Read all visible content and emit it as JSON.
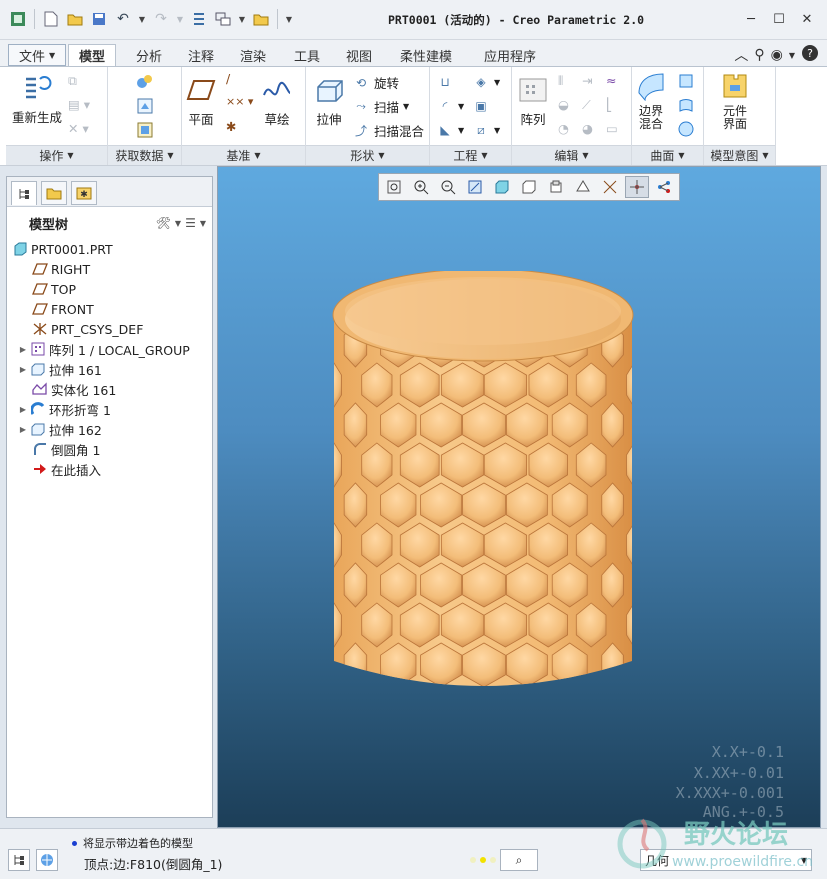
{
  "window": {
    "title": "PRT0001 (活动的) - Creo Parametric 2.0"
  },
  "tabs": [
    {
      "label": "文件",
      "kind": "file"
    },
    {
      "label": "模型",
      "kind": "active"
    },
    {
      "label": "分析"
    },
    {
      "label": "注释"
    },
    {
      "label": "渲染"
    },
    {
      "label": "工具"
    },
    {
      "label": "视图"
    },
    {
      "label": "柔性建模"
    },
    {
      "label": "应用程序"
    }
  ],
  "ribbon": {
    "operations": {
      "regenerate": "重新生成",
      "group": "操作"
    },
    "get_data": {
      "group": "获取数据"
    },
    "datum": {
      "plane": "平面",
      "sketch": "草绘",
      "group": "基准"
    },
    "shapes": {
      "extrude": "拉伸",
      "revolve": "旋转",
      "sweep": "扫描",
      "swept_blend": "扫描混合",
      "group": "形状"
    },
    "engineering": {
      "group": "工程"
    },
    "editing": {
      "pattern": "阵列",
      "group": "编辑"
    },
    "surfaces": {
      "boundary_blend": "边界\n混合",
      "group": "曲面"
    },
    "model_intent": {
      "component_interface": "元件\n界面",
      "group": "模型意图"
    }
  },
  "tree": {
    "title": "模型树",
    "nodes": [
      {
        "label": "PRT0001.PRT",
        "icon": "part-icon",
        "expand": false,
        "level": 0
      },
      {
        "label": "RIGHT",
        "icon": "datum-plane-icon",
        "expand": false,
        "level": 1
      },
      {
        "label": "TOP",
        "icon": "datum-plane-icon",
        "expand": false,
        "level": 1
      },
      {
        "label": "FRONT",
        "icon": "datum-plane-icon",
        "expand": false,
        "level": 1
      },
      {
        "label": "PRT_CSYS_DEF",
        "icon": "csys-icon",
        "expand": false,
        "level": 1
      },
      {
        "label": "阵列 1 / LOCAL_GROUP",
        "icon": "pattern-icon",
        "expand": true,
        "level": 1
      },
      {
        "label": "拉伸 161",
        "icon": "extrude-icon",
        "expand": true,
        "level": 1
      },
      {
        "label": "实体化 161",
        "icon": "solidify-icon",
        "expand": false,
        "level": 1
      },
      {
        "label": "环形折弯 1",
        "icon": "toroidal-bend-icon",
        "expand": true,
        "level": 1
      },
      {
        "label": "拉伸 162",
        "icon": "extrude-icon",
        "expand": true,
        "level": 1
      },
      {
        "label": "倒圆角 1",
        "icon": "round-icon",
        "expand": false,
        "level": 1
      },
      {
        "label": "在此插入",
        "icon": "insert-here-icon",
        "expand": false,
        "level": 1
      }
    ]
  },
  "tolerances": [
    "X.X+-0.1",
    "X.XX+-0.01",
    "X.XXX+-0.001",
    "ANG.+-0.5"
  ],
  "status": {
    "message": "将显示带边着色的模型",
    "selection_info": "顶点:边:F810(倒圆角_1)",
    "filter_value": "几何"
  },
  "watermark": {
    "title": "野火论坛",
    "url": "www.proewildfire.cn"
  },
  "colors": {
    "part": "#f5be7a",
    "viewport_top": "#5fa9df",
    "viewport_bottom": "#1c3e58"
  }
}
